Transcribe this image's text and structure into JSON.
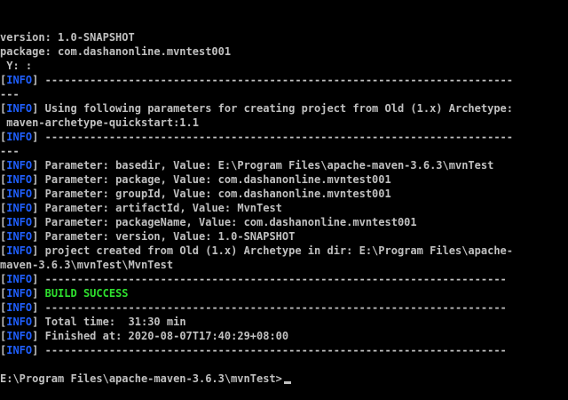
{
  "colors": {
    "background": "#000000",
    "text": "#c0c0c0",
    "info_tag": "#1f5fff",
    "success": "#2ee02e"
  },
  "lines": [
    {
      "kind": "plain",
      "text": "version: 1.0-SNAPSHOT"
    },
    {
      "kind": "plain",
      "text": "package: com.dashanonline.mvntest001"
    },
    {
      "kind": "plain",
      "text": " Y: :"
    },
    {
      "kind": "info",
      "text": " -------------------------------------------------------------------------"
    },
    {
      "kind": "plain",
      "text": "---"
    },
    {
      "kind": "info",
      "text": " Using following parameters for creating project from Old (1.x) Archetype:"
    },
    {
      "kind": "plain",
      "text": " maven-archetype-quickstart:1.1"
    },
    {
      "kind": "info",
      "text": " -------------------------------------------------------------------------"
    },
    {
      "kind": "plain",
      "text": "---"
    },
    {
      "kind": "info",
      "text": " Parameter: basedir, Value: E:\\Program Files\\apache-maven-3.6.3\\mvnTest"
    },
    {
      "kind": "info",
      "text": " Parameter: package, Value: com.dashanonline.mvntest001"
    },
    {
      "kind": "info",
      "text": " Parameter: groupId, Value: com.dashanonline.mvntest001"
    },
    {
      "kind": "info",
      "text": " Parameter: artifactId, Value: MvnTest"
    },
    {
      "kind": "info",
      "text": " Parameter: packageName, Value: com.dashanonline.mvntest001"
    },
    {
      "kind": "info",
      "text": " Parameter: version, Value: 1.0-SNAPSHOT"
    },
    {
      "kind": "info",
      "text": " project created from Old (1.x) Archetype in dir: E:\\Program Files\\apache-"
    },
    {
      "kind": "plain",
      "text": "maven-3.6.3\\mvnTest\\MvnTest"
    },
    {
      "kind": "info",
      "text": " ------------------------------------------------------------------------"
    },
    {
      "kind": "success",
      "text": " BUILD SUCCESS"
    },
    {
      "kind": "info",
      "text": " ------------------------------------------------------------------------"
    },
    {
      "kind": "info",
      "text": " Total time:  31:30 min"
    },
    {
      "kind": "info",
      "text": " Finished at: 2020-08-07T17:40:29+08:00"
    },
    {
      "kind": "info",
      "text": " ------------------------------------------------------------------------"
    },
    {
      "kind": "plain",
      "text": ""
    },
    {
      "kind": "prompt",
      "text": "E:\\Program Files\\apache-maven-3.6.3\\mvnTest>"
    }
  ],
  "info_tag": {
    "open": "[",
    "label": "INFO",
    "close": "]"
  }
}
